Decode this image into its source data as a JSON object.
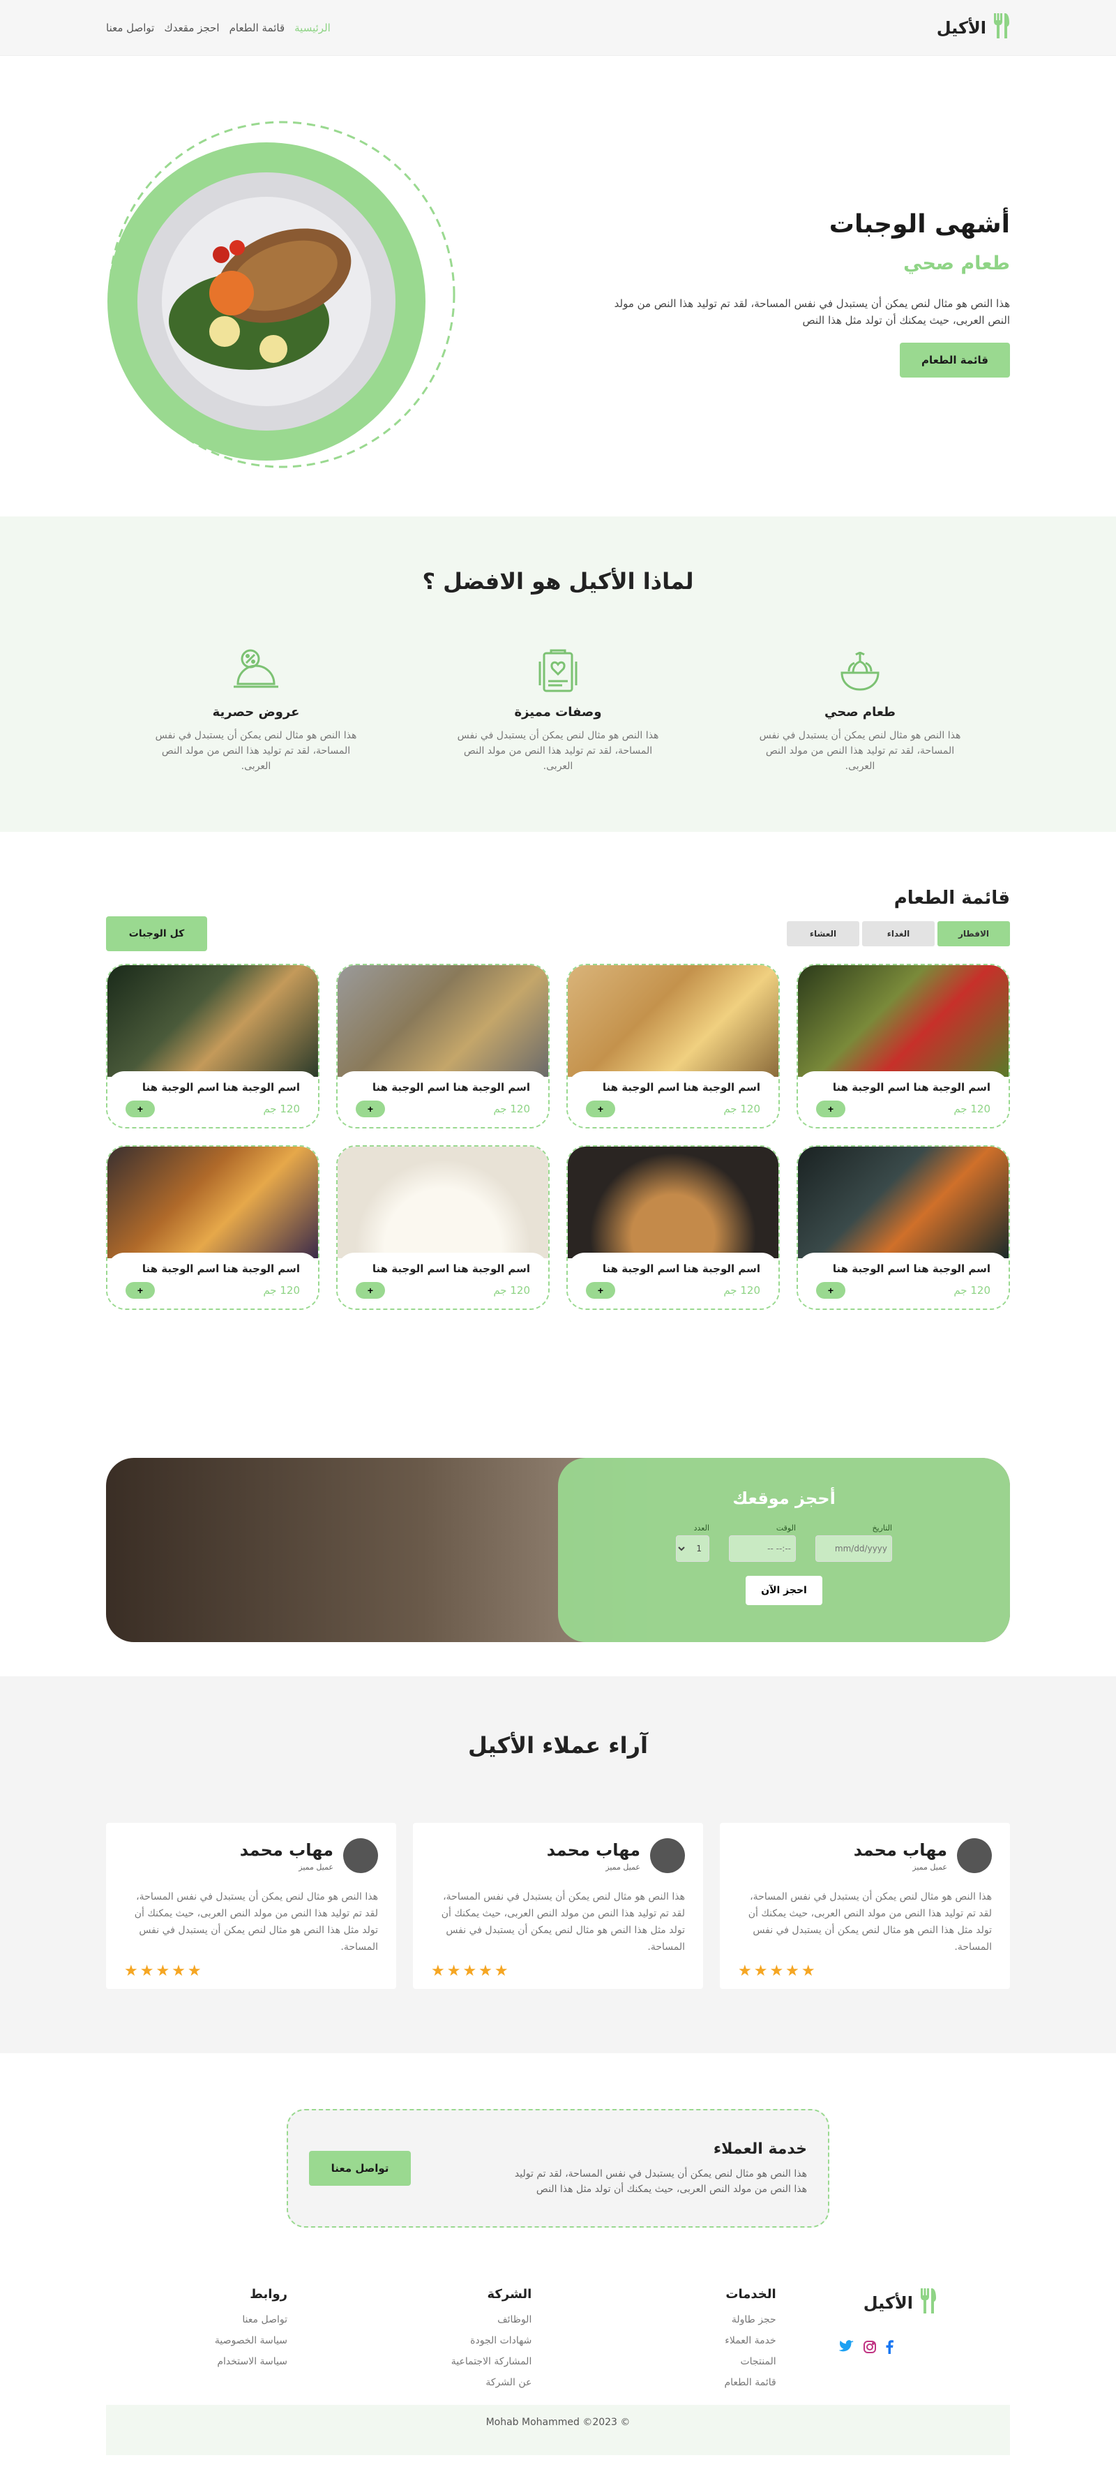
{
  "header": {
    "logo_text": "الأكيل",
    "nav": [
      {
        "label": "الرئيسية",
        "active": true
      },
      {
        "label": "قائمة الطعام",
        "active": false
      },
      {
        "label": "احجز مقعدك",
        "active": false
      },
      {
        "label": "تواصل معنا",
        "active": false
      }
    ]
  },
  "hero": {
    "title": "أشهى الوجبات",
    "subtitle": "طعام صحي",
    "description": "هذا النص هو مثال لنص يمكن أن يستبدل في نفس المساحة، لقد تم توليد هذا النص من مولد النص العربى، حيث يمكنك أن تولد مثل هذا النص",
    "button": "قائمة الطعام"
  },
  "why": {
    "title": "لماذا الأكيل هو الافضل ؟",
    "features": [
      {
        "icon": "healthy-salad-icon",
        "title": "طعام صحي",
        "desc": "هذا النص هو مثال لنص يمكن أن يستبدل في نفس المساحة، لقد تم توليد هذا النص من مولد النص العربى."
      },
      {
        "icon": "menu-recipe-icon",
        "title": "وصفات مميزة",
        "desc": "هذا النص هو مثال لنص يمكن أن يستبدل في نفس المساحة، لقد تم توليد هذا النص من مولد النص العربى."
      },
      {
        "icon": "discount-dish-icon",
        "title": "عروض حصرية",
        "desc": "هذا النص هو مثال لنص يمكن أن يستبدل في نفس المساحة، لقد تم توليد هذا النص من مولد النص العربى."
      }
    ]
  },
  "menu": {
    "title": "قائمة الطعام",
    "tabs": [
      {
        "label": "الافطار",
        "active": true
      },
      {
        "label": "الغداء",
        "active": false
      },
      {
        "label": "العشاء",
        "active": false
      }
    ],
    "all_button": "كل الوجبات",
    "items": [
      {
        "name": "اسم الوجبة هنا اسم الوجبة هنا",
        "price": "120 جم",
        "color": "#7a8a3a"
      },
      {
        "name": "اسم الوجبة هنا اسم الوجبة هنا",
        "price": "120 جم",
        "color": "#c4924c"
      },
      {
        "name": "اسم الوجبة هنا اسم الوجبة هنا",
        "price": "120 جم",
        "color": "#8a7a5a"
      },
      {
        "name": "اسم الوجبة هنا اسم الوجبة هنا",
        "price": "120 جم",
        "color": "#4a5a3a"
      },
      {
        "name": "اسم الوجبة هنا اسم الوجبة هنا",
        "price": "120 جم",
        "color": "#3a4a4a"
      },
      {
        "name": "اسم الوجبة هنا اسم الوجبة هنا",
        "price": "120 جم",
        "color": "#2a2522"
      },
      {
        "name": "اسم الوجبة هنا اسم الوجبة هنا",
        "price": "120 جم",
        "color": "#e8e2d6"
      },
      {
        "name": "اسم الوجبة هنا اسم الوجبة هنا",
        "price": "120 جم",
        "color": "#b06a2a"
      }
    ],
    "add_label": "+"
  },
  "booking": {
    "title": "أحجز موقعك",
    "date_label": "التاريخ",
    "date_placeholder": "mm/dd/yyyy",
    "time_label": "الوقت",
    "time_placeholder": "--:-- --",
    "count_label": "العدد",
    "count_value": "1",
    "button": "احجز الآن"
  },
  "testimonials": {
    "title": "آراء عملاء الأكيل",
    "items": [
      {
        "name": "مهاب محمد",
        "role": "عميل مميز",
        "text": "هذا النص هو مثال لنص يمكن أن يستبدل في نفس المساحة، لقد تم توليد هذا النص من مولد النص العربى، حيث يمكنك أن تولد مثل هذا النص هو مثال لنص يمكن أن يستبدل في نفس المساحة.",
        "stars": "★★★★★"
      },
      {
        "name": "مهاب محمد",
        "role": "عميل مميز",
        "text": "هذا النص هو مثال لنص يمكن أن يستبدل في نفس المساحة، لقد تم توليد هذا النص من مولد النص العربى، حيث يمكنك أن تولد مثل هذا النص هو مثال لنص يمكن أن يستبدل في نفس المساحة.",
        "stars": "★★★★★"
      },
      {
        "name": "مهاب محمد",
        "role": "عميل مميز",
        "text": "هذا النص هو مثال لنص يمكن أن يستبدل في نفس المساحة، لقد تم توليد هذا النص من مولد النص العربى، حيث يمكنك أن تولد مثل هذا النص هو مثال لنص يمكن أن يستبدل في نفس المساحة.",
        "stars": "★★★★★"
      }
    ]
  },
  "service": {
    "title": "خدمة العملاء",
    "desc": "هذا النص هو مثال لنص يمكن أن يستبدل في نفس المساحة، لقد تم توليد هذا النص من مولد النص العربى، حيث يمكنك أن تولد مثل هذا النص",
    "button": "تواصل معنا"
  },
  "footer": {
    "brand": "الأكيل",
    "socials": [
      "twitter-icon",
      "instagram-icon",
      "facebook-icon"
    ],
    "columns": [
      {
        "title": "الخدمات",
        "links": [
          "حجز طاولة",
          "خدمة العملاء",
          "المنتجات",
          "قائمة الطعام"
        ]
      },
      {
        "title": "الشركة",
        "links": [
          "الوظائف",
          "شهادات الجودة",
          "المشاركة الاجتماعية",
          "عن الشركة"
        ]
      },
      {
        "title": "روابط",
        "links": [
          "تواصل معنا",
          "سياسة الخصوصية",
          "سياسة الاستخدام"
        ]
      }
    ],
    "copyright": "© Mohab Mohammed ©2023"
  },
  "colors": {
    "accent": "#9ad990",
    "accent_text": "#8fd486",
    "light_bg": "#f2f8f1"
  }
}
